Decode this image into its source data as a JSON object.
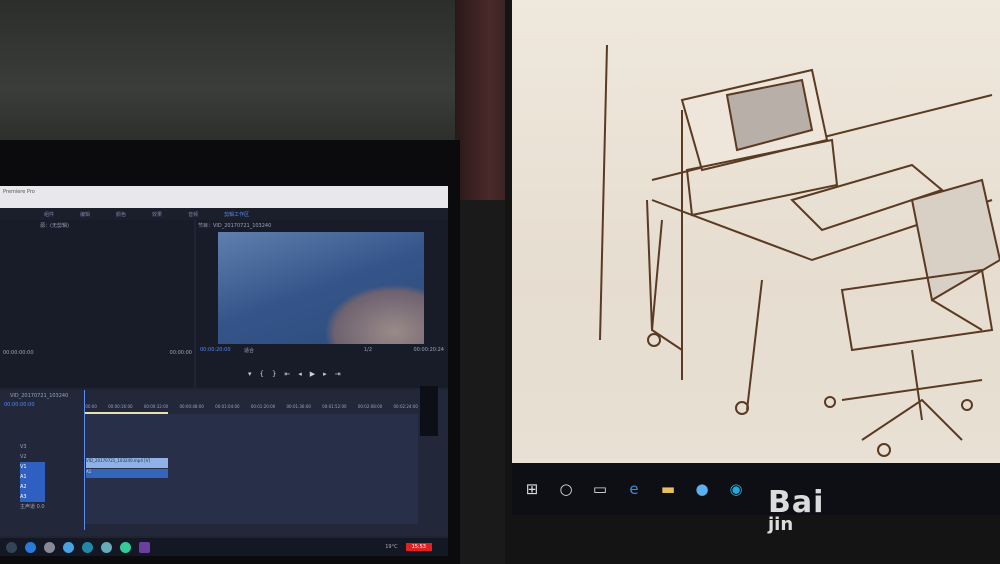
{
  "left_monitor": {
    "app_title": "Premiere Pro",
    "menu": [
      "组件",
      "编辑",
      "颜色",
      "效果",
      "音频",
      "剪辑工作区"
    ],
    "source_panel": {
      "title": "源：(无剪辑)",
      "timecode_left": "00:00:00:00",
      "timecode_right": "00:00:00"
    },
    "program_panel": {
      "title": "节目：VID_20170721_103240",
      "timecode": "00:00:20:00",
      "fit": "适合",
      "quality": "1/2",
      "duration": "00:00:20:24"
    },
    "timeline": {
      "sequence": "VID_20170721_103240",
      "timecode": "00:00:00:00",
      "ruler": [
        ":00:00",
        "00:00:16:00",
        "00:00:32:00",
        "00:00:48:00",
        "00:01:04:00",
        "00:01:20:00",
        "00:01:36:00",
        "00:01:52:00",
        "00:02:08:00",
        "00:02:24:00"
      ],
      "tracks": [
        "V3",
        "V2",
        "V1",
        "A1",
        "A2",
        "A3",
        "主声道"
      ],
      "master_value": "0.0",
      "clip_video": "VID_20170721_103240.mp4 [V]",
      "clip_audio": "A1"
    },
    "taskbar": {
      "temperature": "19°C",
      "time": "15:53"
    }
  },
  "right_monitor": {
    "content": "desk sketch",
    "taskbar_icons": [
      "windows-icon",
      "cortana-icon",
      "task-view-icon",
      "edge-icon",
      "explorer-icon",
      "app-icon",
      "browser-icon"
    ]
  },
  "watermark": "Baidu jingyan"
}
